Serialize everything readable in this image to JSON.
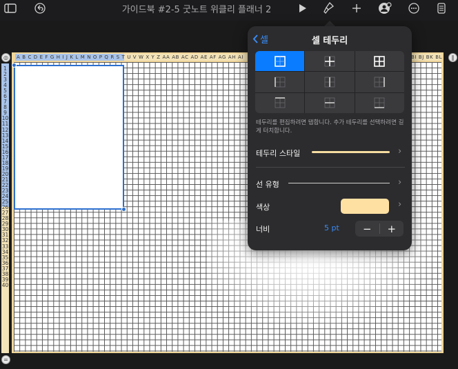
{
  "toolbar": {
    "title": "가이드북 #2-5 굿노트 위클리 플래너 2",
    "icons": [
      "sidebar-icon",
      "undo-icon",
      "play-icon",
      "brush-icon",
      "add-icon",
      "collaborate-icon",
      "more-icon",
      "document-icon"
    ]
  },
  "sheet": {
    "column_labels": "A B C D E F G H I J K L M N O P Q R S T U V W X Y Z AA AB AC AD AE AF AG AH AI",
    "column_labels_right": "BI BJ BK BL",
    "row_labels": [
      "1",
      "2",
      "3",
      "4",
      "5",
      "6",
      "7",
      "8",
      "9",
      "10",
      "11",
      "12",
      "13",
      "14",
      "15",
      "16",
      "17",
      "18",
      "19",
      "20",
      "21",
      "22",
      "23",
      "24",
      "25",
      "26",
      "27",
      "28",
      "29",
      "30",
      "31",
      "32",
      "33",
      "34",
      "35",
      "36",
      "37",
      "38",
      "39",
      "40"
    ]
  },
  "popover": {
    "back_label": "셀",
    "title": "셀 테두리",
    "description": "테두리를 편집하려면 탭합니다. 추가 테두리를 선택하려면 길게 터치합니다.",
    "border_style_label": "테두리 스타일",
    "line_type_label": "선 유형",
    "color_label": "색상",
    "color_value": "#ffe0a3",
    "width_label": "너비",
    "width_value": "5 pt",
    "minus_label": "−",
    "plus_label": "+"
  }
}
